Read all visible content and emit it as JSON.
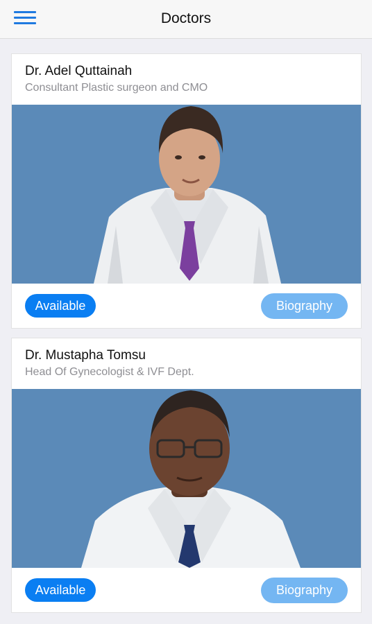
{
  "navbar": {
    "title": "Doctors",
    "menu_icon": "hamburger-menu-icon"
  },
  "doctors": [
    {
      "name": "Dr. Adel Quttainah",
      "title": "Consultant Plastic surgeon and CMO",
      "status": "Available",
      "biography_label": "Biography"
    },
    {
      "name": "Dr. Mustapha Tomsu",
      "title": "Head Of Gynecologist & IVF Dept.",
      "status": "Available",
      "biography_label": "Biography"
    }
  ],
  "colors": {
    "accent": "#0a7ef2",
    "biography_button": "#74b6f2",
    "photo_background": "#5b8ab8"
  }
}
